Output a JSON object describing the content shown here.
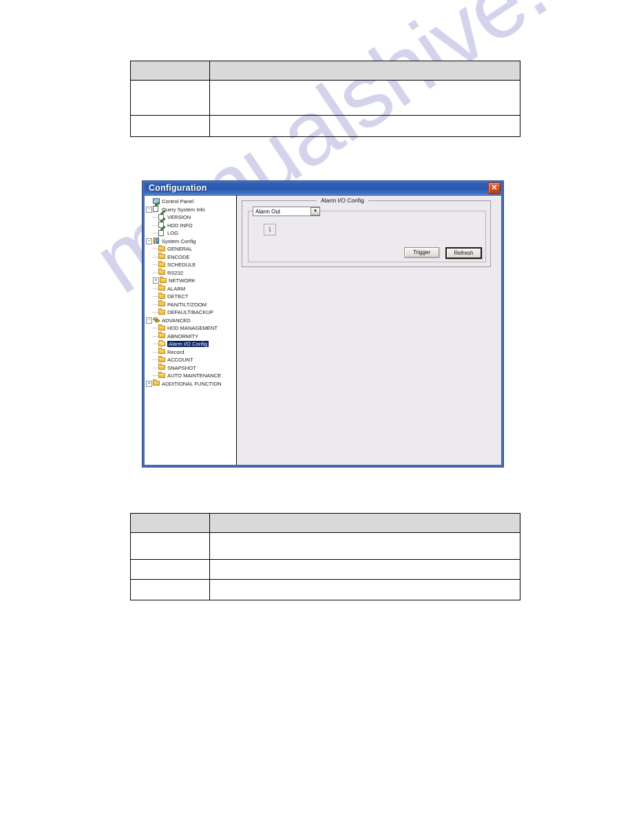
{
  "document": {
    "watermark": "manualshive.com",
    "tables": [
      {
        "id": "table-top",
        "header": [
          "",
          ""
        ],
        "rows": [
          [
            "",
            ""
          ],
          [
            "",
            ""
          ]
        ]
      },
      {
        "id": "table-bottom",
        "header": [
          "",
          ""
        ],
        "rows": [
          [
            "",
            ""
          ],
          [
            "",
            ""
          ],
          [
            "",
            ""
          ]
        ]
      }
    ]
  },
  "window": {
    "title": "Configuration",
    "close_label": "✕",
    "close_icon": "close-icon",
    "tree": [
      {
        "label": "Control Panel",
        "indent": 0,
        "toggle": "",
        "icon": "monitor-icon"
      },
      {
        "label": "Query System Info",
        "indent": 0,
        "toggle": "−",
        "icon": "document-pencil-icon"
      },
      {
        "label": "VERSION",
        "indent": 1,
        "toggle": "",
        "icon": "document-pencil-icon"
      },
      {
        "label": "HDD INFO",
        "indent": 1,
        "toggle": "",
        "icon": "document-pencil-icon"
      },
      {
        "label": "LOG",
        "indent": 1,
        "toggle": "",
        "icon": "document-pencil-icon"
      },
      {
        "label": "System Config",
        "indent": 0,
        "toggle": "−",
        "icon": "tools-icon"
      },
      {
        "label": "GENERAL",
        "indent": 1,
        "toggle": "",
        "icon": "folder-icon"
      },
      {
        "label": "ENCODE",
        "indent": 1,
        "toggle": "",
        "icon": "folder-icon"
      },
      {
        "label": "SCHEDULE",
        "indent": 1,
        "toggle": "",
        "icon": "folder-icon"
      },
      {
        "label": "RS232",
        "indent": 1,
        "toggle": "",
        "icon": "folder-icon"
      },
      {
        "label": "NETWORK",
        "indent": 1,
        "toggle": "+",
        "icon": "folder-icon"
      },
      {
        "label": "ALARM",
        "indent": 1,
        "toggle": "",
        "icon": "folder-icon"
      },
      {
        "label": "DETECT",
        "indent": 1,
        "toggle": "",
        "icon": "folder-icon"
      },
      {
        "label": "PAN/TILT/ZOOM",
        "indent": 1,
        "toggle": "",
        "icon": "folder-icon"
      },
      {
        "label": "DEFAULT/BACKUP",
        "indent": 1,
        "toggle": "",
        "icon": "folder-icon"
      },
      {
        "label": "ADVANCED",
        "indent": 0,
        "toggle": "−",
        "icon": "advanced-icon"
      },
      {
        "label": "HDD MANAGEMENT",
        "indent": 1,
        "toggle": "",
        "icon": "folder-icon"
      },
      {
        "label": "ABNORMITY",
        "indent": 1,
        "toggle": "",
        "icon": "folder-icon"
      },
      {
        "label": "Alarm I/O Config",
        "indent": 1,
        "toggle": "",
        "icon": "folder-open-icon",
        "selected": true
      },
      {
        "label": "Record",
        "indent": 1,
        "toggle": "",
        "icon": "folder-icon"
      },
      {
        "label": "ACCOUNT",
        "indent": 1,
        "toggle": "",
        "icon": "folder-icon"
      },
      {
        "label": "SNAPSHOT",
        "indent": 1,
        "toggle": "",
        "icon": "folder-icon"
      },
      {
        "label": "AUTO MAINTENANCE",
        "indent": 1,
        "toggle": "",
        "icon": "folder-icon"
      },
      {
        "label": "ADDITIONAL FUNCTION",
        "indent": 0,
        "toggle": "+",
        "icon": "folder-icon"
      }
    ],
    "panel": {
      "group_title": "Alarm I/O Config",
      "channel_select": {
        "value": "Alarm Out",
        "arrow_icon": "chevron-down-icon"
      },
      "channel_number": "1",
      "buttons": {
        "trigger": "Trigger",
        "refresh": "Refresh"
      }
    }
  },
  "colors": {
    "titlebar_blue": "#2a59b0",
    "window_border": "#4a6cab",
    "selection_blue": "#0a246a",
    "table_header_gray": "#d9d9d9",
    "pane_background": "#ece9ef",
    "watermark": "#b9bbe2"
  }
}
